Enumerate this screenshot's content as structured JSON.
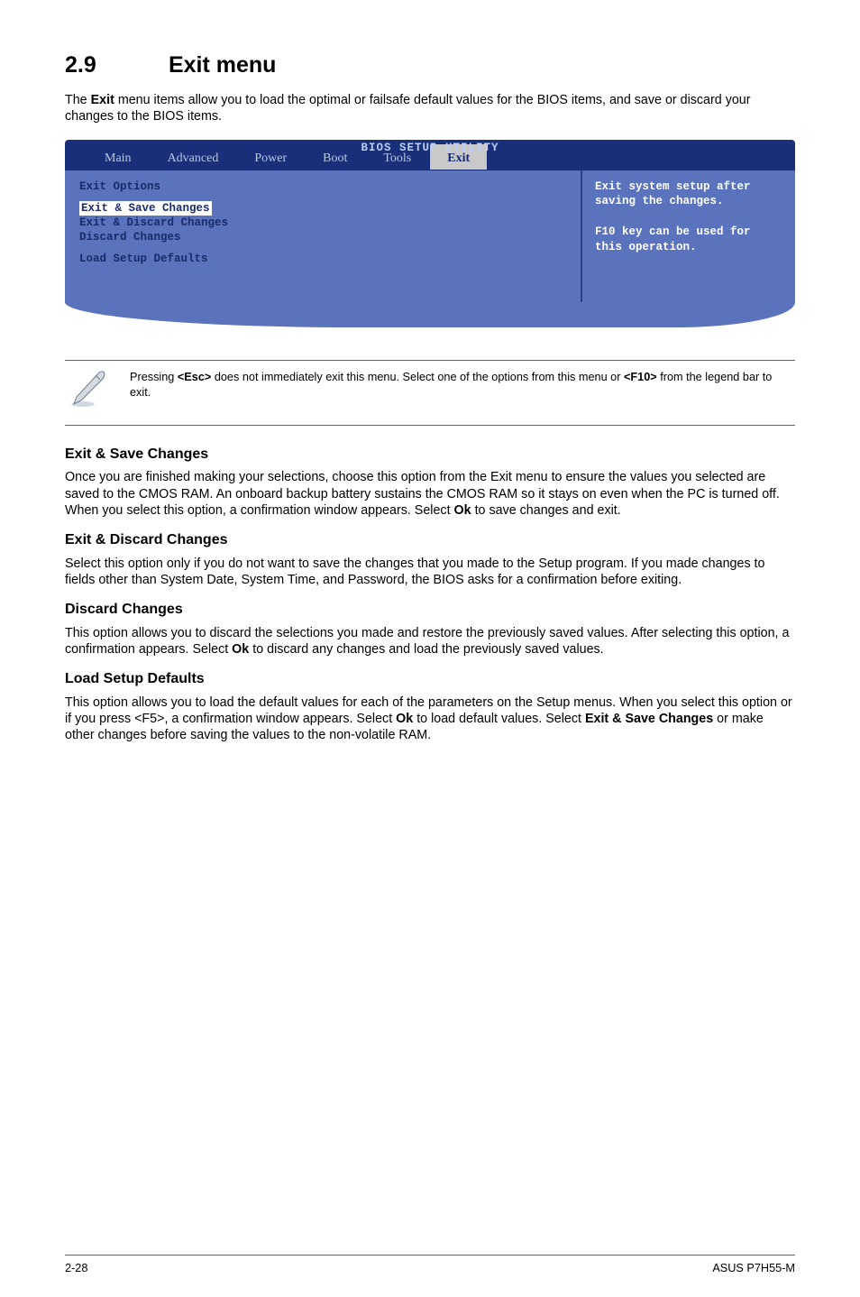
{
  "heading": {
    "number": "2.9",
    "title": "Exit menu"
  },
  "intro_parts": {
    "p1": "The ",
    "bold1": "Exit",
    "p2": " menu items allow you to load the optimal or failsafe default values for the BIOS items, and save or discard your changes to the BIOS items."
  },
  "bios": {
    "utility_title": "BIOS SETUP UTILITY",
    "tabs": [
      "Main",
      "Advanced",
      "Power",
      "Boot",
      "Tools",
      "Exit"
    ],
    "selected_tab": "Exit",
    "left": {
      "heading": "Exit Options",
      "items": [
        "Exit & Save Changes",
        "Exit & Discard Changes",
        "Discard Changes",
        "Load Setup Defaults"
      ]
    },
    "right_help": "Exit system setup after saving the changes.\n\nF10 key can be used for this operation."
  },
  "note": {
    "p1": "Pressing ",
    "b1": "<Esc>",
    "p2": " does not immediately exit this menu. Select one of the options from this menu or ",
    "b2": "<F10>",
    "p3": " from the legend bar to exit."
  },
  "sections": {
    "s1": {
      "title": "Exit & Save Changes",
      "p_a": "Once you are finished making your selections, choose this option from the Exit menu to ensure the values you selected are saved to the CMOS RAM. An onboard backup battery sustains the CMOS RAM so it stays on even when the PC is turned off. When you select this option, a confirmation window appears. Select ",
      "p_b_bold": "Ok",
      "p_c": " to save changes and exit."
    },
    "s2": {
      "title": "Exit & Discard Changes",
      "p": "Select this option only if you do not want to save the changes that you  made to the Setup program. If you made changes to fields other than System Date, System Time, and Password, the BIOS asks for a confirmation before exiting."
    },
    "s3": {
      "title": "Discard Changes",
      "p_a": "This option allows you to discard the selections you made and restore the previously saved values. After selecting this option, a confirmation appears. Select ",
      "p_b_bold": "Ok",
      "p_c": " to discard any changes and load the previously saved values."
    },
    "s4": {
      "title": "Load Setup Defaults",
      "p_a": "This option allows you to load the default values for each of the parameters on the Setup menus. When you select this option or if you press <F5>, a confirmation window appears. Select ",
      "p_b_bold": "Ok",
      "p_c": " to load default values. Select ",
      "p_d_bold": "Exit & Save Changes",
      "p_e": " or make other changes before saving the values to the non-volatile RAM."
    }
  },
  "footer": {
    "left": "2-28",
    "right": "ASUS P7H55-M"
  },
  "icons": {
    "note": "note-icon"
  }
}
